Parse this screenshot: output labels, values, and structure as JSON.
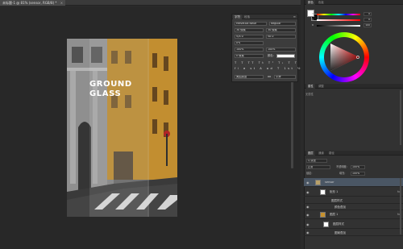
{
  "document_tab": {
    "title": "未标题-1 @ 81% (sensor, RGB/8) *",
    "close": "×"
  },
  "artwork": {
    "title_line1": "GROUND",
    "title_line2": "GLASS"
  },
  "character_panel": {
    "tabs": [
      "字符",
      "段落"
    ],
    "menu": "≡",
    "font_family": "Helvetica Neue",
    "font_style": "Regular",
    "size": "30 像素",
    "leading": "30 像素",
    "kerning": "V/A 0",
    "tracking": "VA 0",
    "tracking_pct": "0%",
    "vscale": "100%",
    "hscale": "100%",
    "baseline": "0 像素",
    "color_label": "颜色:",
    "style_buttons": "T T TT Tt T¹ T₁ T T",
    "opentype_buttons": "fi σ st A ad T 1st ½",
    "language": "美国英语",
    "antialias_label": "aa",
    "antialias": "平滑"
  },
  "color_panel": {
    "tabs": [
      "颜色",
      "色板"
    ],
    "sliders": [
      {
        "label": "H",
        "value": "0"
      },
      {
        "label": "S",
        "value": "0"
      },
      {
        "label": "B",
        "value": "100"
      }
    ]
  },
  "properties_panel": {
    "tabs": [
      "属性",
      "调整"
    ],
    "subtitle": "无属性"
  },
  "layers_panel": {
    "tabs": [
      "图层",
      "通道",
      "路径"
    ],
    "filter_kind": "Q 类型",
    "blend_mode": "正常",
    "opacity_label": "不透明度:",
    "opacity": "100%",
    "lock_label": "锁定:",
    "fill_label": "填充:",
    "fill": "100%",
    "layers": [
      {
        "name": "sensor",
        "type": "group",
        "selected": true,
        "fx": ""
      },
      {
        "name": "矩形 1",
        "type": "shape",
        "selected": false,
        "fx": "fx"
      },
      {
        "name": "图层样式",
        "type": "effect",
        "selected": false,
        "fx": ""
      },
      {
        "name": "颜色叠加",
        "type": "effect",
        "selected": false,
        "fx": ""
      },
      {
        "name": "图层 1",
        "type": "image",
        "selected": false,
        "fx": "fx"
      },
      {
        "name": "图层样式",
        "type": "effect",
        "selected": false,
        "fx": ""
      },
      {
        "name": "图案叠加",
        "type": "effect",
        "selected": false,
        "fx": ""
      }
    ]
  },
  "colors": {
    "accent_selection": "#4a5664",
    "building_yellow": "#c8922e",
    "panel_bg": "#323232",
    "canvas_bg": "#282828"
  }
}
